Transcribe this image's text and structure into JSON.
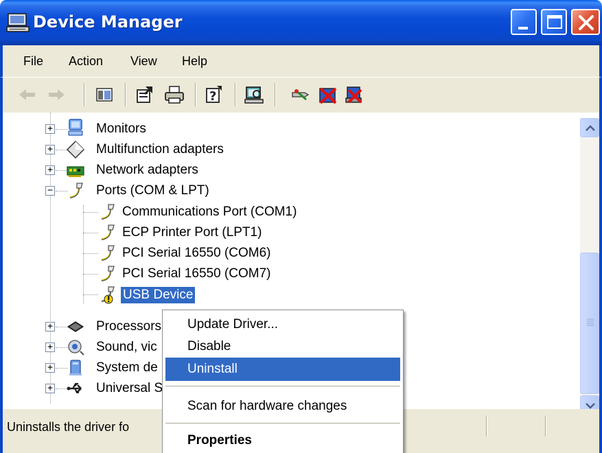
{
  "window": {
    "title": "Device Manager"
  },
  "menubar": {
    "items": [
      "File",
      "Action",
      "View",
      "Help"
    ]
  },
  "toolbar": {
    "buttons": [
      "back-icon",
      "forward-icon",
      "show-hide-console-tree-icon",
      "properties-icon",
      "print-icon",
      "help-icon",
      "scan-hardware-icon",
      "update-driver-icon",
      "disable-icon",
      "uninstall-icon"
    ]
  },
  "tree": {
    "items": [
      {
        "label": "Monitors",
        "icon": "monitor-icon",
        "expandable": true
      },
      {
        "label": "Multifunction adapters",
        "icon": "multifunction-icon",
        "expandable": true
      },
      {
        "label": "Network adapters",
        "icon": "network-adapter-icon",
        "expandable": true
      },
      {
        "label": "Ports (COM & LPT)",
        "icon": "port-icon",
        "expandable": true,
        "expanded": true
      },
      {
        "label": "Communications Port (COM1)",
        "icon": "port-icon"
      },
      {
        "label": "ECP Printer Port (LPT1)",
        "icon": "port-icon"
      },
      {
        "label": "PCI Serial 16550 (COM6)",
        "icon": "port-icon"
      },
      {
        "label": "PCI Serial 16550 (COM7)",
        "icon": "port-icon"
      },
      {
        "label": "USB Device",
        "icon": "port-warning-icon",
        "selected": true
      },
      {
        "label": "Processors",
        "icon": "processor-icon",
        "expandable": true
      },
      {
        "label": "Sound, vic",
        "icon": "sound-icon",
        "expandable": true
      },
      {
        "label": "System de",
        "icon": "system-device-icon",
        "expandable": true
      },
      {
        "label": "Universal S",
        "icon": "usb-icon",
        "expandable": true
      }
    ]
  },
  "context_menu": {
    "items": [
      {
        "label": "Update Driver..."
      },
      {
        "label": "Disable"
      },
      {
        "label": "Uninstall",
        "highlighted": true
      },
      {
        "label": "Scan for hardware changes"
      },
      {
        "label": "Properties",
        "bold": true
      }
    ]
  },
  "statusbar": {
    "text": "Uninstalls the driver fo"
  }
}
